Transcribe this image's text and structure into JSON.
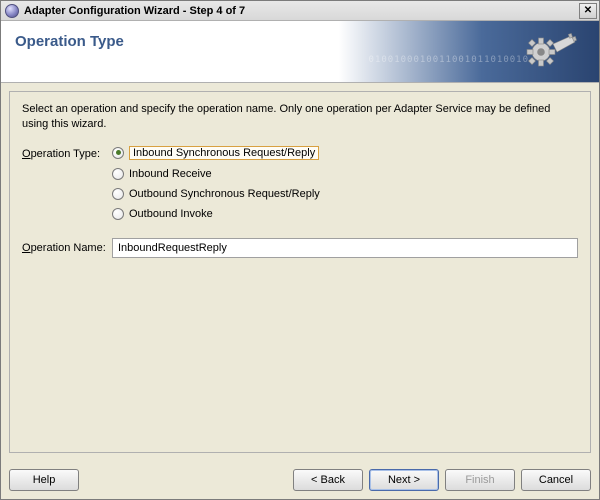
{
  "window": {
    "title": "Adapter Configuration Wizard - Step 4 of 7",
    "close_glyph": "✕"
  },
  "header": {
    "heading": "Operation Type",
    "digits": "0100100010011001011010010"
  },
  "content": {
    "intro": "Select an operation and specify the operation name. Only one operation per Adapter Service may be defined using this wizard.",
    "operation_type_label": "Operation Type:",
    "operation_name_label": "Operation Name:",
    "radio_options": [
      {
        "label": "Inbound Synchronous Request/Reply",
        "selected": true
      },
      {
        "label": "Inbound Receive",
        "selected": false
      },
      {
        "label": "Outbound Synchronous Request/Reply",
        "selected": false
      },
      {
        "label": "Outbound Invoke",
        "selected": false
      }
    ],
    "operation_name_value": "InboundRequestReply"
  },
  "footer": {
    "help": "Help",
    "back": "< Back",
    "next": "Next >",
    "finish": "Finish",
    "cancel": "Cancel"
  }
}
